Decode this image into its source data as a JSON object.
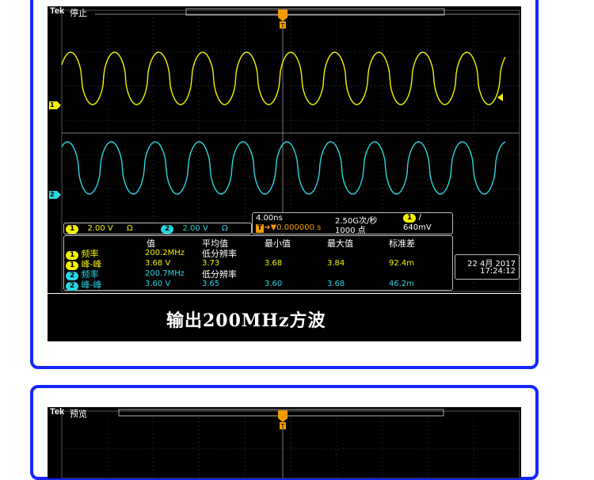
{
  "scope1": {
    "brand": "Tek",
    "status": "停止",
    "channel_settings": {
      "ch1_label": "1",
      "ch1_scale": "2.00 V",
      "ch1_unit": "Ω",
      "ch2_label": "2",
      "ch2_scale": "2.00 V",
      "ch2_unit": "Ω"
    },
    "timebase": {
      "time_per_div": "4.00ns",
      "sample_rate": "2.50G次/秒",
      "trigger_channel": "1",
      "trigger_slope": "/",
      "trigger_position": "0.000000 s",
      "trigger_icon": "T",
      "record_length": "1000 点",
      "trigger_level": "640mV"
    },
    "measurements": {
      "headers": [
        "值",
        "平均值",
        "最小值",
        "最大值",
        "标准差"
      ],
      "rows": [
        {
          "channel": "1",
          "name": "频率",
          "value": "200.2MHz",
          "mean": "低分辨率",
          "min": "",
          "max": "",
          "std": ""
        },
        {
          "channel": "1",
          "name": "峰-峰",
          "value": "3.68 V",
          "mean": "3.73",
          "min": "3.68",
          "max": "3.84",
          "std": "92.4m"
        },
        {
          "channel": "2",
          "name": "频率",
          "value": "200.7MHz",
          "mean": "低分辨率",
          "min": "",
          "max": "",
          "std": ""
        },
        {
          "channel": "2",
          "name": "峰-峰",
          "value": "3.60 V",
          "mean": "3.65",
          "min": "3.60",
          "max": "3.68",
          "std": "46.2m"
        }
      ]
    },
    "datetime": {
      "date": "22 4月 2017",
      "time": "17:24:12"
    },
    "ch1_marker": "1",
    "ch2_marker": "2"
  },
  "caption": "输出200MHz方波",
  "scope2": {
    "brand": "Tek",
    "status": "预览"
  },
  "colors": {
    "ch1": "#f2f200",
    "ch2": "#29d6e2",
    "trigger": "#f29a00",
    "panel_border": "#1526ff"
  },
  "icons": [
    "trigger-position-marker-icon",
    "trigger-level-arrow-icon",
    "channel1-ground-marker-icon",
    "channel2-ground-marker-icon"
  ]
}
